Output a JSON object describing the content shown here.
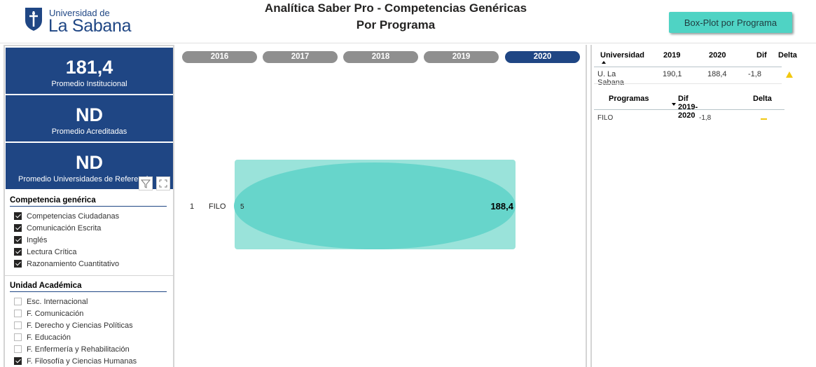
{
  "header": {
    "logo_small": "Universidad de",
    "logo_big": "La Sabana",
    "title_line1": "Analítica Saber Pro - Competencias Genéricas",
    "title_line2": "Por Programa",
    "boxplot_button": "Box-Plot por Programa"
  },
  "cards": [
    {
      "value": "181,4",
      "label": "Promedio Institucional"
    },
    {
      "value": "ND",
      "label": "Promedio Acreditadas"
    },
    {
      "value": "ND",
      "label": "Promedio Universidades de Referencia"
    }
  ],
  "slicer_competencia": {
    "title": "Competencia genérica",
    "items": [
      {
        "label": "Competencias Ciudadanas",
        "checked": true
      },
      {
        "label": "Comunicación Escrita",
        "checked": true
      },
      {
        "label": "Inglés",
        "checked": true
      },
      {
        "label": "Lectura Crítica",
        "checked": true
      },
      {
        "label": "Razonamiento Cuantitativo",
        "checked": true
      }
    ]
  },
  "slicer_unidad": {
    "title": "Unidad Académica",
    "items": [
      {
        "label": "Esc. Internacional",
        "checked": false
      },
      {
        "label": "F. Comunicación",
        "checked": false
      },
      {
        "label": "F. Derecho y Ciencias Políticas",
        "checked": false
      },
      {
        "label": "F. Educación",
        "checked": false
      },
      {
        "label": "F. Enfermería y Rehabilitación",
        "checked": false
      },
      {
        "label": "F. Filosofía y Ciencias Humanas",
        "checked": true
      }
    ]
  },
  "years": [
    "2016",
    "2017",
    "2018",
    "2019",
    "2020"
  ],
  "selected_year": "2020",
  "chart_data": {
    "type": "bar",
    "categories": [
      "FILO"
    ],
    "row_index": [
      "1"
    ],
    "count_labels": [
      "5"
    ],
    "value_labels": [
      "188,4"
    ],
    "values": [
      188.4
    ]
  },
  "univ_table": {
    "headers": [
      "Universidad",
      "2019",
      "2020",
      "Dif",
      "Delta"
    ],
    "rows": [
      {
        "name": "U. La Sabana",
        "y2019": "190,1",
        "y2020": "188,4",
        "dif": "-1,8",
        "delta": "up-triangle"
      }
    ]
  },
  "prog_table": {
    "headers": [
      "Programas",
      "Dif 2019-2020",
      "Delta"
    ],
    "rows": [
      {
        "name": "FILO",
        "dif": "-1,8",
        "delta": "dash"
      }
    ]
  },
  "colors": {
    "brand": "#1f4684",
    "teal": "#4fd3c4",
    "bar_light": "#9ae3da",
    "bar_dark": "#67d5cb",
    "pill_inactive": "#8f8f8f",
    "delta": "#f2c811"
  }
}
